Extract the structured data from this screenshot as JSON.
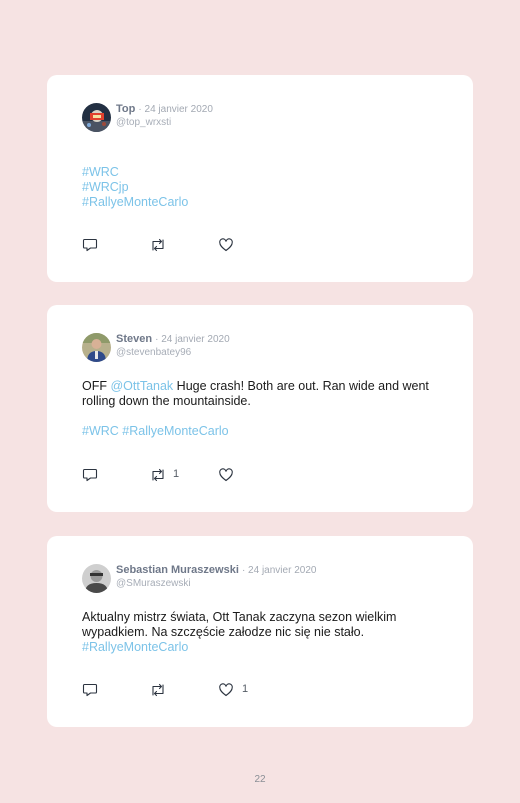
{
  "tweets": [
    {
      "name": "Top",
      "date": "· 24 janvier 2020",
      "handle": "@top_wrxsti",
      "paragraphs": [
        [
          {
            "text": "#WRC",
            "link": true
          }
        ],
        [
          {
            "text": "#WRCjp",
            "link": true
          }
        ],
        [
          {
            "text": "#RallyeMonteCarlo",
            "link": true
          }
        ]
      ],
      "retweets": "",
      "likes": ""
    },
    {
      "name": "Steven",
      "date": "· 24 janvier 2020",
      "handle": "@stevenbatey96",
      "paragraphs": [
        [
          {
            "text": "OFF ",
            "link": false
          },
          {
            "text": "@OttTanak",
            "link": true
          },
          {
            "text": " Huge crash! Both are out. Ran wide and went rolling down the mountainside.",
            "link": false
          }
        ],
        [],
        [
          {
            "text": "#WRC",
            "link": true
          },
          {
            "text": " ",
            "link": false
          },
          {
            "text": "#RallyeMonteCarlo",
            "link": true
          }
        ]
      ],
      "retweets": "1",
      "likes": ""
    },
    {
      "name": "Sebastian Muraszewski",
      "date": "· 24 janvier 2020",
      "handle": "@SMuraszewski",
      "paragraphs": [
        [
          {
            "text": "Aktualny mistrz świata, Ott Tanak zaczyna sezon wielkim wypadkiem. Na szczęście załodze nic się nie stało.",
            "link": false
          }
        ],
        [
          {
            "text": "#RallyeMonteCarlo",
            "link": true
          }
        ]
      ],
      "retweets": "",
      "likes": "1"
    }
  ],
  "icons": {
    "reply": "speech-bubble-icon",
    "retweet": "retweet-arrows-icon",
    "like": "heart-outline-icon"
  },
  "colors": {
    "background": "#f6e3e3",
    "link": "#7cc3e8"
  },
  "page_number": "22"
}
